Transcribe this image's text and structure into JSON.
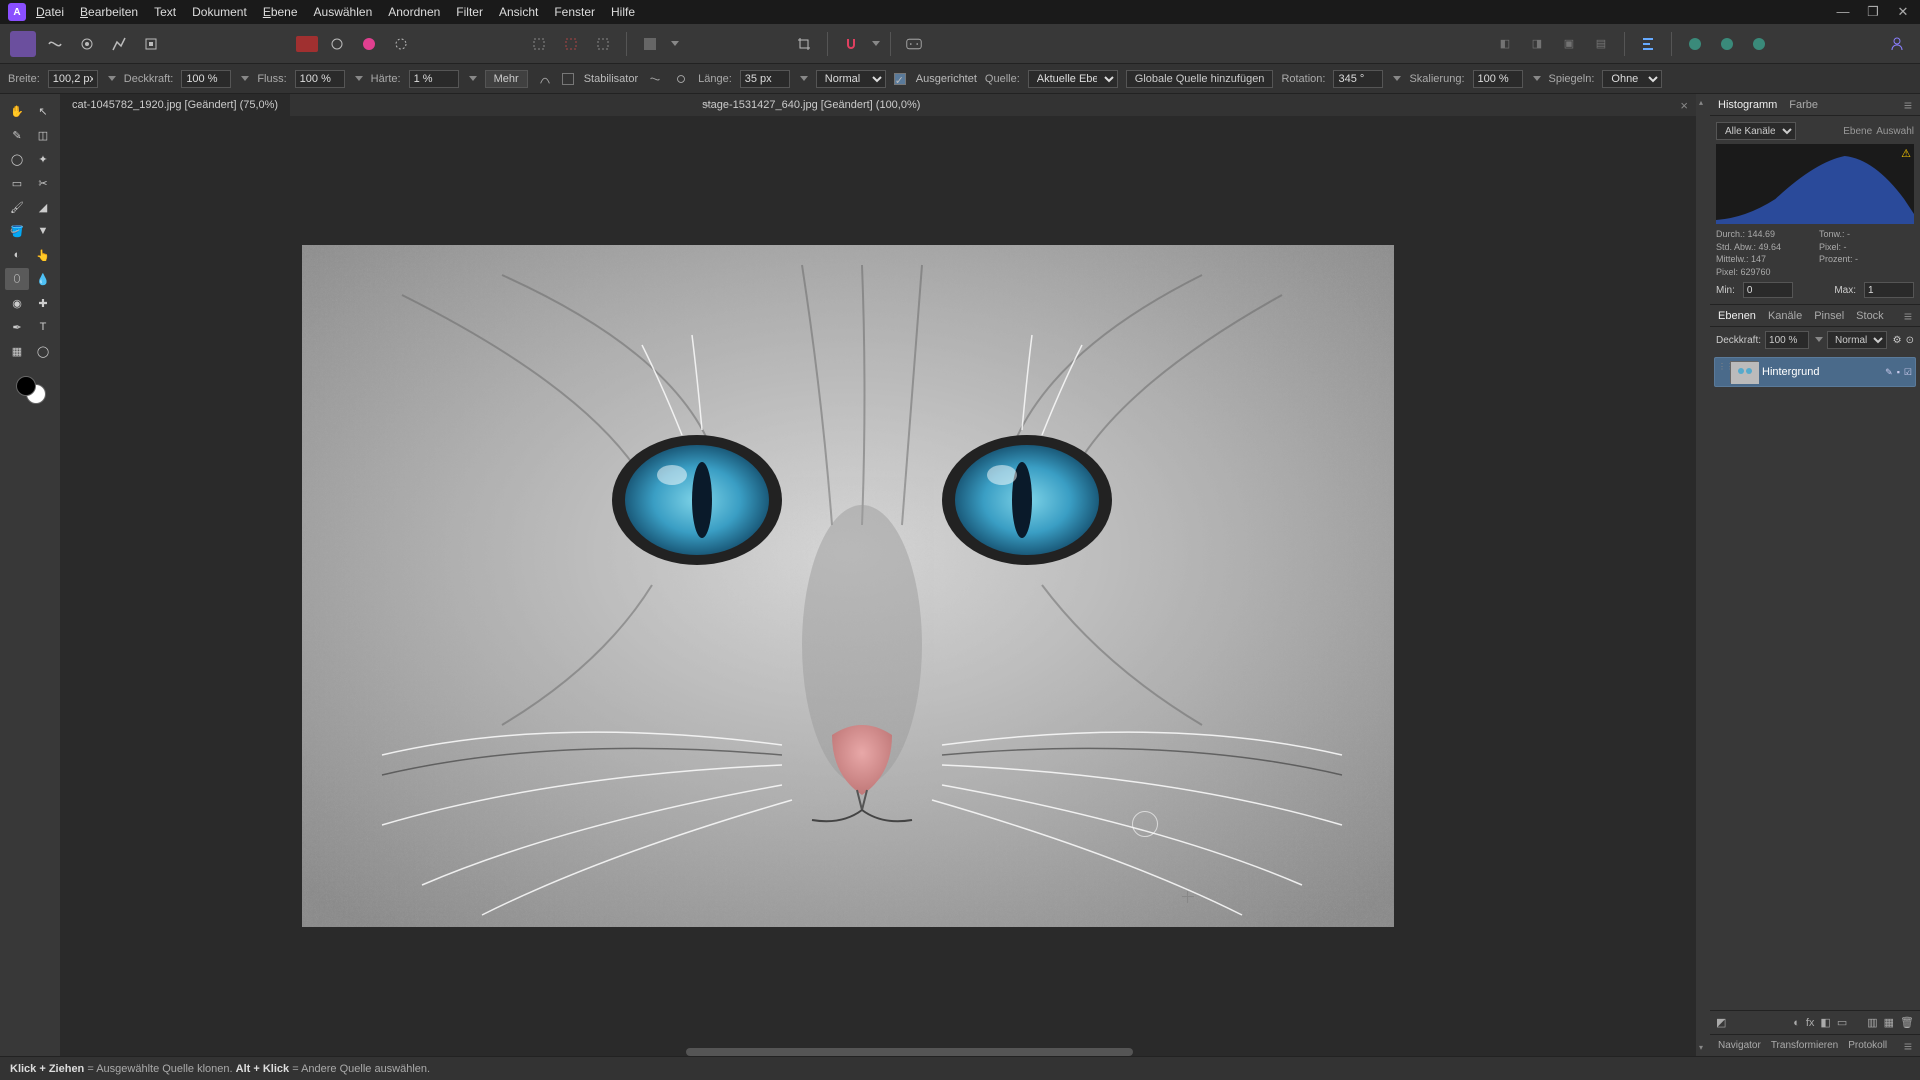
{
  "menu": {
    "items": [
      "Datei",
      "Bearbeiten",
      "Text",
      "Dokument",
      "Ebene",
      "Auswählen",
      "Anordnen",
      "Filter",
      "Ansicht",
      "Fenster",
      "Hilfe"
    ]
  },
  "context": {
    "width_label": "Breite:",
    "width": "100,2 px",
    "opacity_label": "Deckkraft:",
    "opacity": "100 %",
    "flow_label": "Fluss:",
    "flow": "100 %",
    "hardness_label": "Härte:",
    "hardness": "1 %",
    "more": "Mehr",
    "stabilizer": "Stabilisator",
    "length_label": "Länge:",
    "length": "35 px",
    "blend": "Normal",
    "aligned": "Ausgerichtet",
    "source_label": "Quelle:",
    "source": "Aktuelle Ebene",
    "add_global": "Globale Quelle hinzufügen",
    "rotation_label": "Rotation:",
    "rotation": "345 °",
    "scale_label": "Skalierung:",
    "scale": "100 %",
    "mirror_label": "Spiegeln:",
    "mirror": "Ohne"
  },
  "tabs": {
    "tab1": "cat-1045782_1920.jpg [Geändert] (75,0%)",
    "tab2": "stage-1531427_640.jpg [Geändert] (100,0%)"
  },
  "histogram": {
    "tab_histogram": "Histogramm",
    "tab_color": "Farbe",
    "channels": "Alle Kanäle",
    "btn_layer": "Ebene",
    "btn_selection": "Auswahl",
    "stat_mean": "Durch.: 144.69",
    "stat_stddev": "Std. Abw.: 49.64",
    "stat_median": "Mittelw.: 147",
    "stat_pixels": "Pixel: 629760",
    "stat_tone": "Tonw.: -",
    "stat_pix": "Pixel: -",
    "stat_percent": "Prozent: -",
    "min_label": "Min:",
    "min": "0",
    "max_label": "Max:",
    "max": "1"
  },
  "layers": {
    "tab_layers": "Ebenen",
    "tab_channels": "Kanäle",
    "tab_brush": "Pinsel",
    "tab_stock": "Stock",
    "opacity_label": "Deckkraft:",
    "opacity": "100 %",
    "blend": "Normal",
    "layer_name": "Hintergrund"
  },
  "bottom_tabs": {
    "navigator": "Navigator",
    "transform": "Transformieren",
    "history": "Protokoll"
  },
  "status": {
    "part1": "Klick + Ziehen",
    "part2": " = Ausgewählte Quelle klonen. ",
    "part3": "Alt + Klick",
    "part4": " = Andere Quelle auswählen."
  }
}
